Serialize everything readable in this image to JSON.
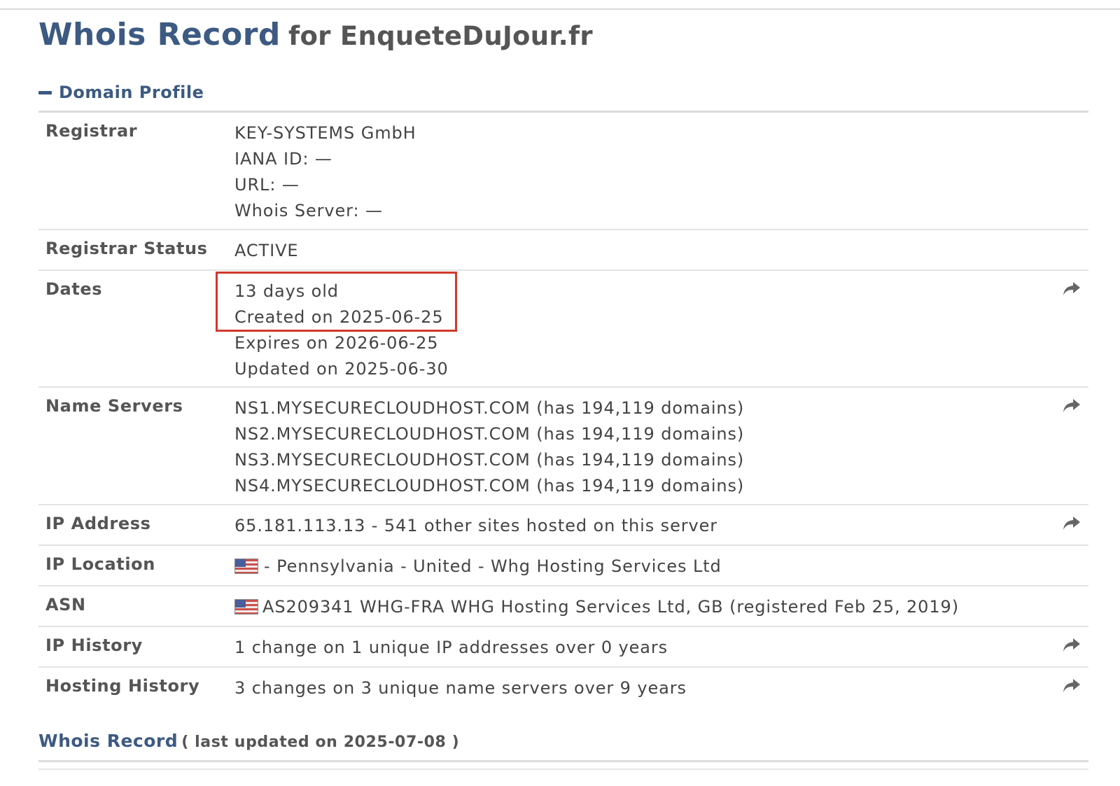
{
  "page": {
    "heading_main": "Whois Record",
    "heading_sub": "for EnqueteDuJour.fr"
  },
  "domain_profile": {
    "section_title": "Domain Profile",
    "rows": [
      {
        "label": "Registrar",
        "lines": [
          "KEY-SYSTEMS GmbH",
          "IANA ID: —",
          "URL: —",
          "Whois Server: —"
        ]
      },
      {
        "label": "Registrar Status",
        "lines": [
          "ACTIVE"
        ]
      },
      {
        "label": "Dates",
        "lines": [
          "13 days old",
          "Created on 2025-06-25",
          "Expires on 2026-06-25",
          "Updated on 2025-06-30"
        ]
      },
      {
        "label": "Name Servers",
        "lines": [
          "NS1.MYSECURECLOUDHOST.COM (has 194,119 domains)",
          "NS2.MYSECURECLOUDHOST.COM (has 194,119 domains)",
          "NS3.MYSECURECLOUDHOST.COM (has 194,119 domains)",
          "NS4.MYSECURECLOUDHOST.COM (has 194,119 domains)"
        ]
      },
      {
        "label": "IP Address",
        "lines": [
          "65.181.113.13 - 541 other sites hosted on this server"
        ]
      },
      {
        "label": "IP Location",
        "lines": [
          "- Pennsylvania - United - Whg Hosting Services Ltd"
        ]
      },
      {
        "label": "ASN",
        "lines": [
          "AS209341 WHG-FRA WHG Hosting Services Ltd, GB (registered Feb 25, 2019)"
        ]
      },
      {
        "label": "IP History",
        "lines": [
          "1 change on 1 unique IP addresses over 0 years"
        ]
      },
      {
        "label": "Hosting History",
        "lines": [
          "3 changes on 3 unique name servers over 9 years"
        ]
      }
    ]
  },
  "whois_record": {
    "link_label": "Whois Record",
    "updated_text": "( last updated on 2025-07-08 )"
  },
  "icons": {
    "collapse": "minus-icon",
    "share": "share-arrow-icon",
    "flag": "us-flag-icon"
  },
  "colors": {
    "accent": "#3c5a82",
    "highlight": "#cf3a2c"
  }
}
